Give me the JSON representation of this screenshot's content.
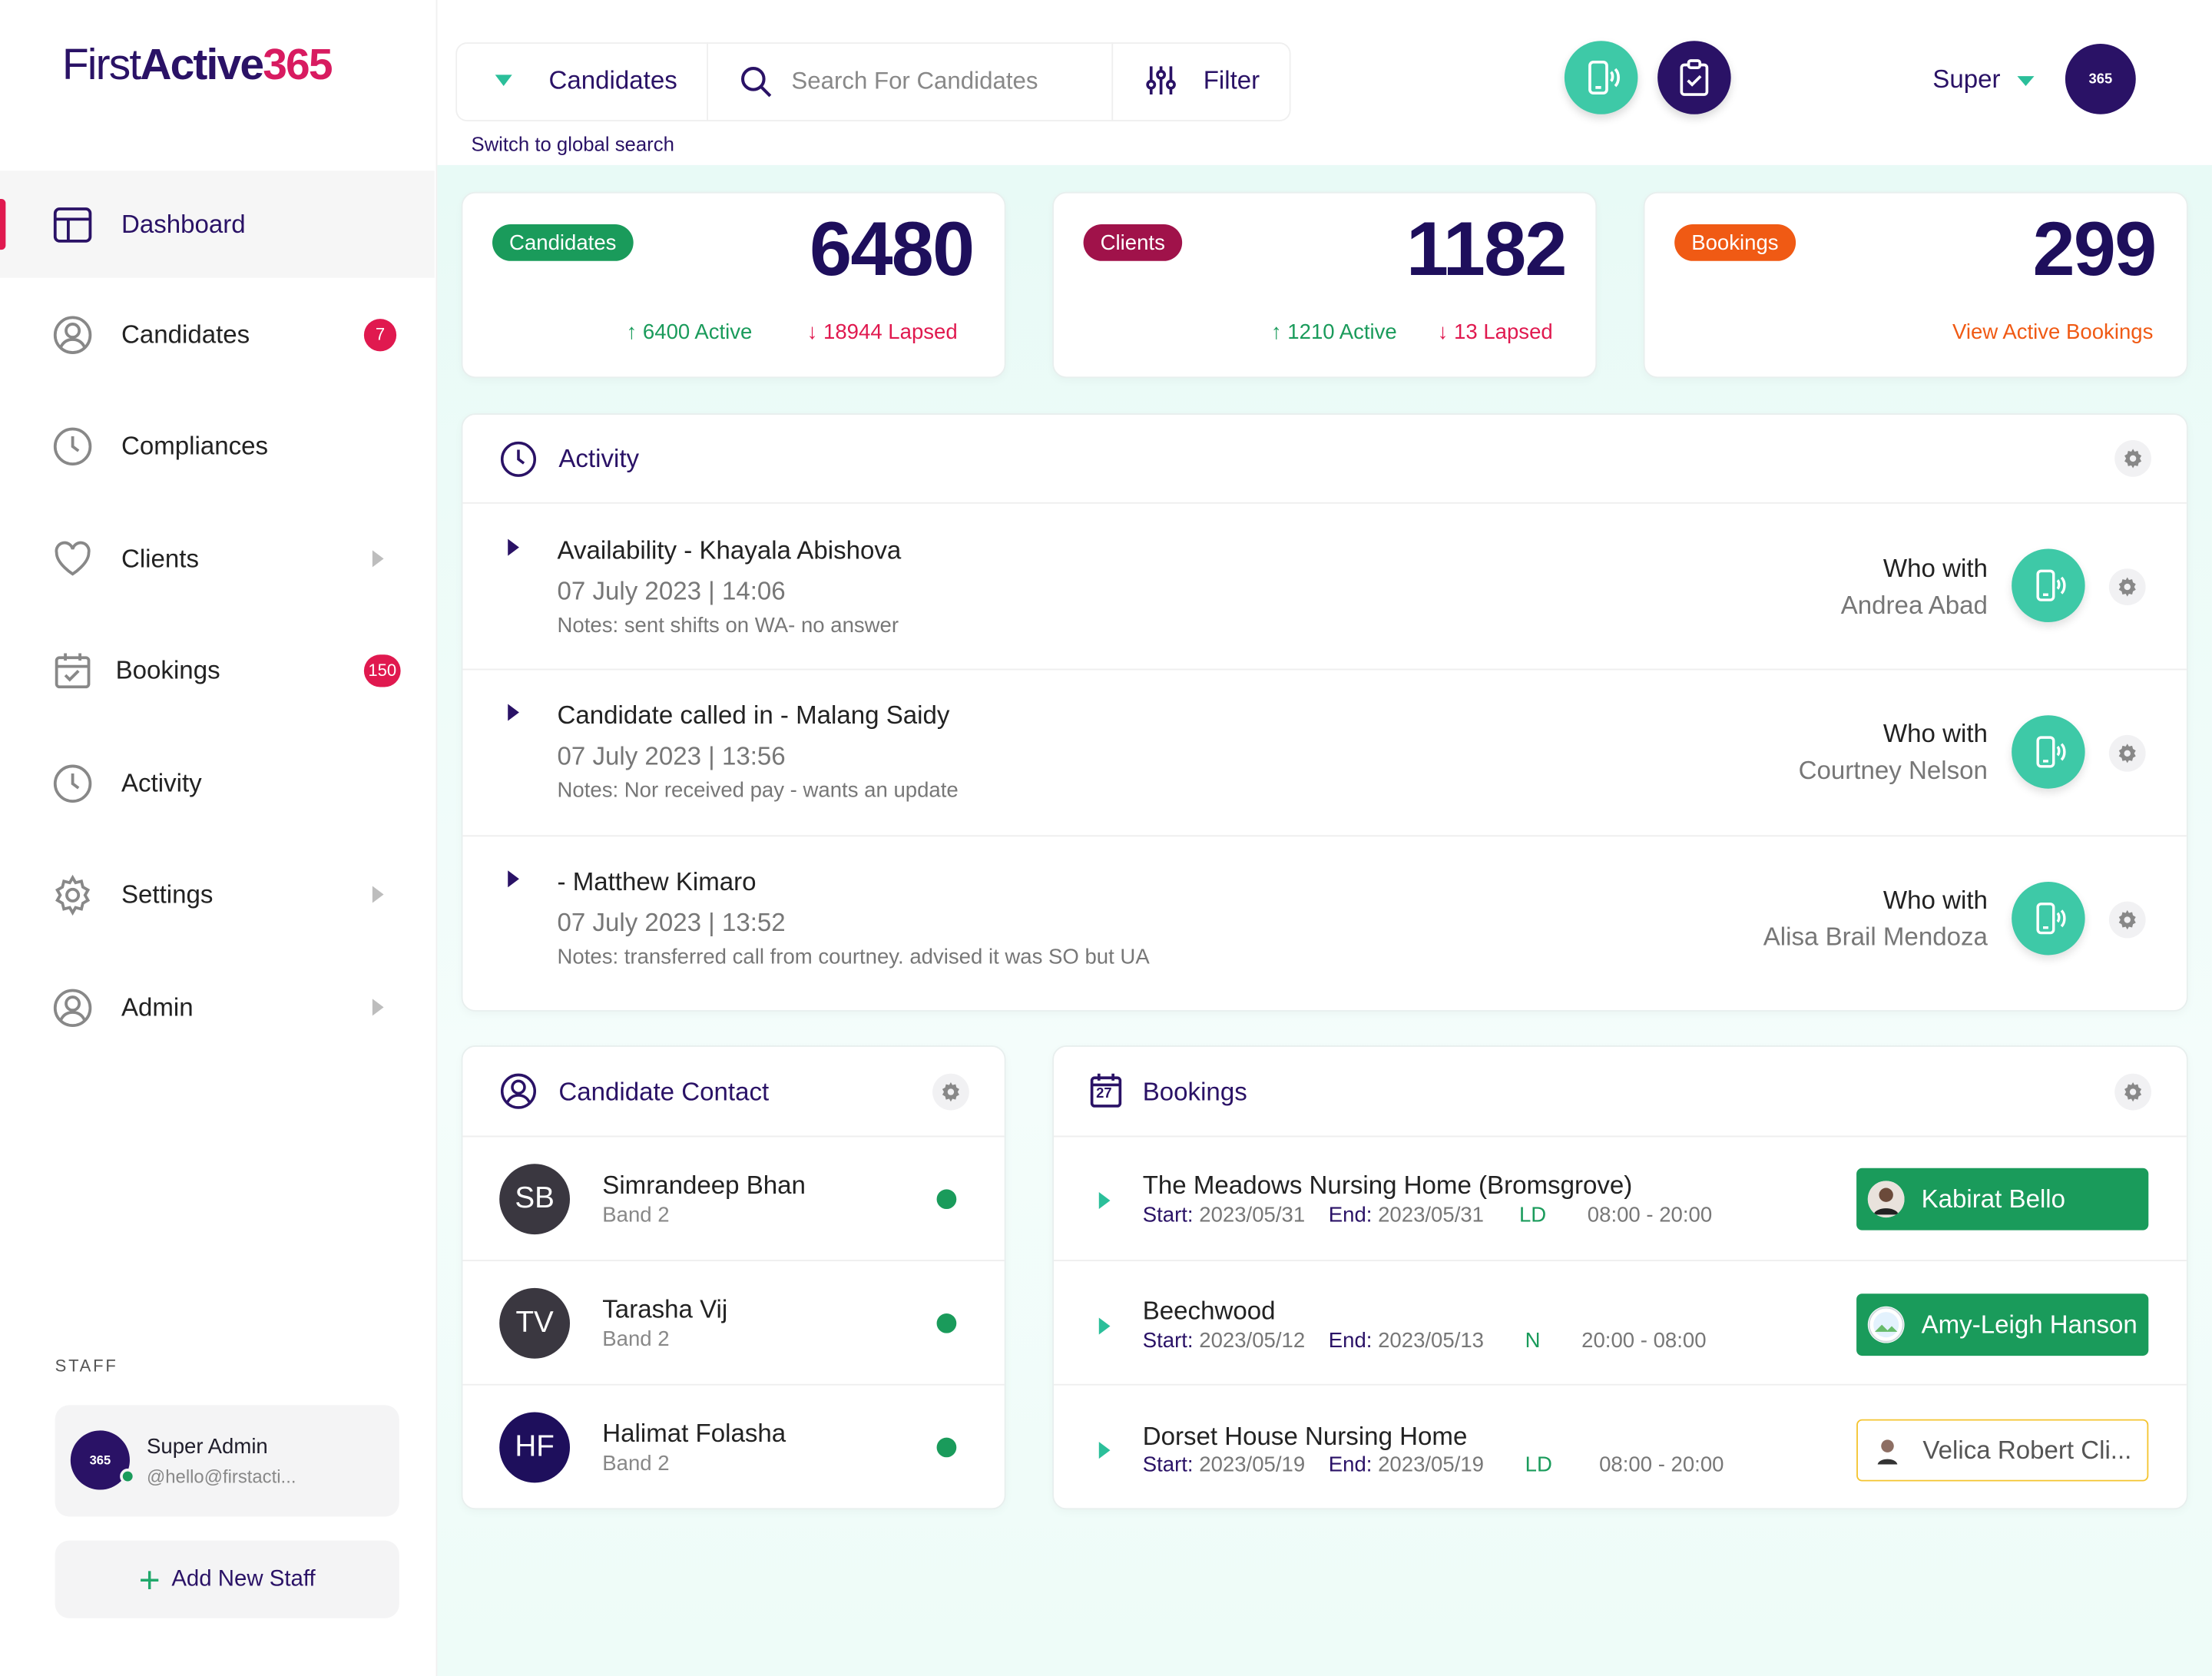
{
  "app": {
    "logo_first": "First",
    "logo_active": "Active",
    "logo_num": "365"
  },
  "sidebar": {
    "items": [
      {
        "label": "Dashboard",
        "icon": "dashboard-icon",
        "active": true
      },
      {
        "label": "Candidates",
        "icon": "user-circle-icon",
        "badge": "7"
      },
      {
        "label": "Compliances",
        "icon": "clock-icon"
      },
      {
        "label": "Clients",
        "icon": "heart-icon"
      },
      {
        "label": "Bookings",
        "icon": "calendar-check-icon",
        "badge": "150"
      },
      {
        "label": "Activity",
        "icon": "clock-icon"
      },
      {
        "label": "Settings",
        "icon": "gear-icon"
      },
      {
        "label": "Admin",
        "icon": "user-circle-icon"
      }
    ],
    "staff_title": "STAFF",
    "staff_name": "Super Admin",
    "staff_email": "@hello@firstacti...",
    "add_staff": "Add New Staff"
  },
  "topbar": {
    "search_scope": "Candidates",
    "search_placeholder": "Search For Candidates",
    "filter": "Filter",
    "global_search": "Switch to global search",
    "user": "Super"
  },
  "stats": [
    {
      "pill": "Candidates",
      "pill_color": "#1a9b5b",
      "value": "6480",
      "up": "6400 Active",
      "down": "18944 Lapsed"
    },
    {
      "pill": "Clients",
      "pill_color": "#a0124a",
      "value": "1182",
      "up": "1210 Active",
      "down": "13 Lapsed"
    },
    {
      "pill": "Bookings",
      "pill_color": "#f05a14",
      "value": "299",
      "link": "View Active Bookings"
    }
  ],
  "activity": {
    "title": "Activity",
    "who_label": "Who with",
    "items": [
      {
        "title": "Availability - Khayala Abishova",
        "date": "07 July 2023 | 14:06",
        "note": "Notes: sent shifts on WA- no answer",
        "who": "Andrea Abad"
      },
      {
        "title": "Candidate called in - Malang Saidy",
        "date": "07 July 2023 | 13:56",
        "note": "Notes: Nor received pay - wants an update",
        "who": "Courtney Nelson"
      },
      {
        "title": "- Matthew Kimaro",
        "date": "07 July 2023 | 13:52",
        "note": "Notes: transferred call from courtney. advised it was SO but UA",
        "who": "Alisa Brail Mendoza"
      }
    ]
  },
  "candidate_contact": {
    "title": "Candidate Contact",
    "items": [
      {
        "initials": "SB",
        "name": "Simrandeep Bhan",
        "band": "Band 2",
        "color": "#3a3740"
      },
      {
        "initials": "TV",
        "name": "Tarasha Vij",
        "band": "Band 2",
        "color": "#3a3740"
      },
      {
        "initials": "HF",
        "name": "Halimat Folasha",
        "band": "Band 2",
        "color": "#1e0f5c"
      }
    ]
  },
  "bookings": {
    "title": "Bookings",
    "calendar_day": "27",
    "start_label": "Start:",
    "end_label": "End:",
    "items": [
      {
        "title": "The Meadows Nursing Home (Bromsgrove)",
        "start": "2023/05/31",
        "end": "2023/05/31",
        "shift": "LD",
        "time": "08:00 - 20:00",
        "staff": "Kabirat Bello",
        "status": "confirmed"
      },
      {
        "title": "Beechwood",
        "start": "2023/05/12",
        "end": "2023/05/13",
        "shift": "N",
        "time": "20:00 - 08:00",
        "staff": "Amy-Leigh Hanson",
        "status": "confirmed"
      },
      {
        "title": "Dorset House Nursing Home",
        "start": "2023/05/19",
        "end": "2023/05/19",
        "shift": "LD",
        "time": "08:00 - 20:00",
        "staff": "Velica Robert Cli...",
        "status": "pending"
      }
    ]
  },
  "colors": {
    "brand": "#2a1266",
    "accent": "#e0194f",
    "teal": "#3ec9a7",
    "green": "#1a9b5b",
    "orange": "#f05a14"
  }
}
